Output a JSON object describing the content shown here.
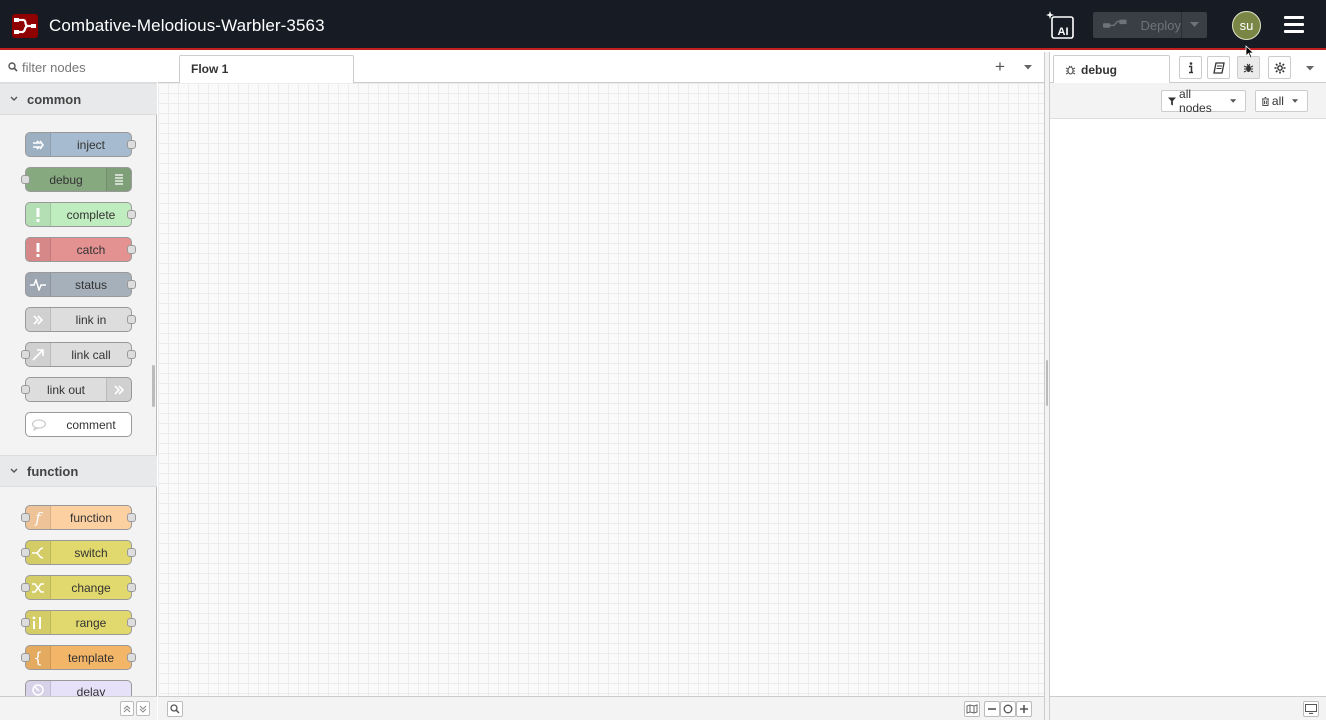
{
  "header": {
    "title": "Combative-Melodious-Warbler-3563",
    "ai_label": "AI",
    "deploy_label": "Deploy",
    "user_initials": "su",
    "icons": [
      "node-red-logo-icon",
      "ai-assistant-icon",
      "deploy-icon",
      "chevron-down-icon",
      "hamburger-menu-icon"
    ]
  },
  "palette": {
    "search_placeholder": "filter nodes",
    "categories": [
      {
        "name": "common",
        "nodes": [
          {
            "label": "inject",
            "color": "#a6bbcf"
          },
          {
            "label": "debug",
            "color": "#87a980"
          },
          {
            "label": "complete",
            "color": "#c0edc0"
          },
          {
            "label": "catch",
            "color": "#e49191"
          },
          {
            "label": "status",
            "color": "#94c1d0"
          },
          {
            "label": "link in",
            "color": "#dddddd"
          },
          {
            "label": "link call",
            "color": "#dddddd"
          },
          {
            "label": "link out",
            "color": "#dddddd"
          },
          {
            "label": "comment",
            "color": "#ffffff"
          }
        ]
      },
      {
        "name": "function",
        "nodes": [
          {
            "label": "function",
            "color": "#fdd0a2"
          },
          {
            "label": "switch",
            "color": "#e2d96e"
          },
          {
            "label": "change",
            "color": "#e2d96e"
          },
          {
            "label": "range",
            "color": "#e2d96e"
          },
          {
            "label": "template",
            "color": "#f3b567"
          },
          {
            "label": "delay",
            "color": "#e6e0f8"
          }
        ]
      }
    ]
  },
  "workspace": {
    "tabs": [
      {
        "label": "Flow 1"
      }
    ]
  },
  "sidebar": {
    "active_tab": "debug",
    "filter_label": "all nodes",
    "clear_label": "all"
  },
  "colors": {
    "header_bg": "#171b24",
    "accent_red": "#c02020",
    "avatar_bg": "#7a8646"
  }
}
